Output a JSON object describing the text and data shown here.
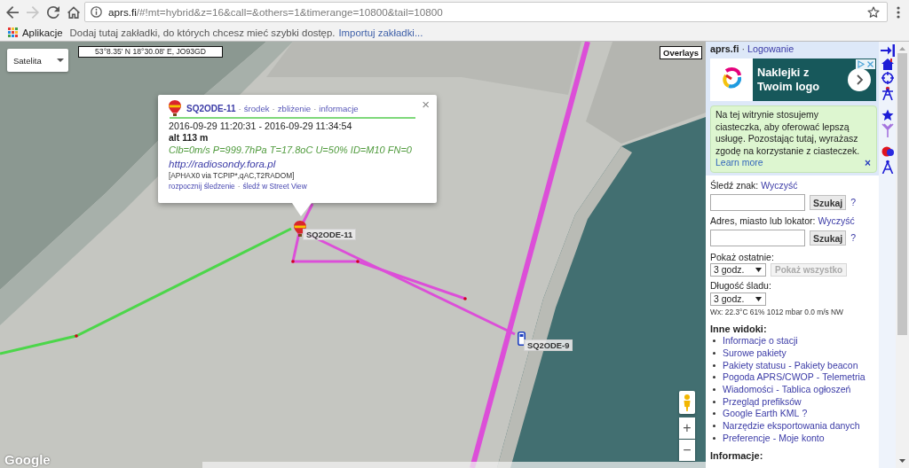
{
  "browser": {
    "nav_buttons": [
      {
        "kind": "back",
        "disabled": false
      },
      {
        "kind": "forward",
        "disabled": true
      },
      {
        "kind": "reload",
        "disabled": false
      },
      {
        "kind": "home",
        "disabled": false
      }
    ],
    "address_bar": {
      "host": "aprs.fi",
      "path": "/#!mt=hybrid&z=16&call=&others=1&timerange=10800&tail=10800"
    },
    "bookmarks_bar": {
      "apps_label": "Aplikacje",
      "hint": "Dodaj tutaj zakładki, do których chcesz mieć szybki dostęp.",
      "import_link": "Importuj zakładki..."
    }
  },
  "map": {
    "map_type": "Satelita",
    "coordinates": "53°8.35' N 18°30.08' E, JO93GD",
    "overlays_button": "Overlays",
    "popup": {
      "station": "SQ2ODE-11",
      "separator": "·",
      "links": [
        "środek",
        "zbliżenie",
        "informacje"
      ],
      "time_range": "2016-09-29 11:20:31 - 2016-09-29 11:34:54",
      "altitude": "alt 113 m",
      "comment": "Clb=0m/s P=999.7hPa T=17.8oC U=50% ID=M10 FN=0",
      "url": "http://radiosondy.fora.pl",
      "path": "[APHAX0 via TCPIP*,qAC,T2RADOM]",
      "actions": [
        "rozpocznij śledzenie",
        "śledź w Street View"
      ],
      "close": "×"
    },
    "stations": [
      {
        "kind": "balloon",
        "label": "SQ2ODE-11"
      },
      {
        "kind": "car",
        "label": "SQ2ODE-9"
      }
    ],
    "zoom_buttons": [
      "+",
      "−"
    ],
    "logo": "Google"
  },
  "sidebar": {
    "header": {
      "site": "aprs.fi",
      "separator": "·",
      "login_link": "Logowanie"
    },
    "ad": {
      "headline": "Naklejki z Twoim logo"
    },
    "cookie_notice": {
      "text": "Na tej witrynie stosujemy ciasteczka, aby oferować lepszą usługę. Pozostając tutaj, wyrażasz zgodę na korzystanie z ciasteczek.",
      "link": "Learn more",
      "close": "×"
    },
    "search_forms": [
      {
        "label": "Śledź znak:",
        "clear_link": "Wyczyść",
        "button": "Szukaj",
        "help": "?"
      },
      {
        "label": "Adres, miasto lub lokator:",
        "clear_link": "Wyczyść",
        "button": "Szukaj",
        "help": "?"
      }
    ],
    "show_last": {
      "label": "Pokaż ostatnie:",
      "value": "3 godz.",
      "button": {
        "label": "Pokaż wszystko",
        "disabled": true
      }
    },
    "track_length": {
      "label": "Długość śladu:",
      "value": "3 godz."
    },
    "weather": "Wx: 22.3°C 61% 1012 mbar 0.0 m/s NW",
    "other_views": {
      "title": "Inne widoki:",
      "separator": "-",
      "items": [
        {
          "links": [
            "Informacje o stacji"
          ]
        },
        {
          "links": [
            "Surowe pakiety"
          ]
        },
        {
          "links": [
            "Pakiety statusu",
            "Pakiety beacon"
          ]
        },
        {
          "links": [
            "Pogoda APRS/CWOP",
            "Telemetria"
          ]
        },
        {
          "links": [
            "Wiadomości",
            "Tablica ogłoszeń"
          ]
        },
        {
          "links": [
            "Przegląd prefiksów"
          ]
        },
        {
          "links": [
            "Google Earth KML"
          ],
          "help": "?"
        },
        {
          "links": [
            "Narzędzie eksportowania danych"
          ]
        },
        {
          "links": [
            "Preferencje",
            "Moje konto"
          ]
        }
      ]
    },
    "info_title": "Informacje:"
  }
}
